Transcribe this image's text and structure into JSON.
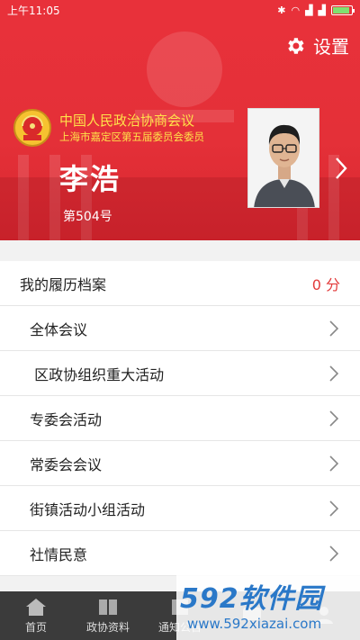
{
  "status_bar": {
    "time": "上午11:05"
  },
  "header": {
    "settings_label": "设置",
    "org_name": "中国人民政治协商会议",
    "org_subtitle": "上海市嘉定区第五届委员会委员",
    "member_name": "李浩",
    "member_number": "第504号"
  },
  "record": {
    "title": "我的履历档案",
    "score": "0 分"
  },
  "items": [
    {
      "label": "全体会议"
    },
    {
      "label": " 区政协组织重大活动"
    },
    {
      "label": "专委会活动"
    },
    {
      "label": "常委会会议"
    },
    {
      "label": "街镇活动小组活动"
    },
    {
      "label": "社情民意"
    }
  ],
  "bottom_nav": [
    {
      "label": "首页",
      "icon": "home-icon"
    },
    {
      "label": "政协资料",
      "icon": "book-icon"
    },
    {
      "label": "通知公告",
      "icon": "notice-icon"
    },
    {
      "label": "",
      "icon": "chat-icon"
    },
    {
      "label": "",
      "icon": "user-icon"
    }
  ],
  "watermark": {
    "brand": "592软件园",
    "url": "www.592xiazai.com"
  },
  "colors": {
    "header_red": "#e8313a",
    "accent_yellow": "#ffe14a",
    "score_red": "#e23a3a",
    "nav_bg": "#3b3b3b"
  }
}
